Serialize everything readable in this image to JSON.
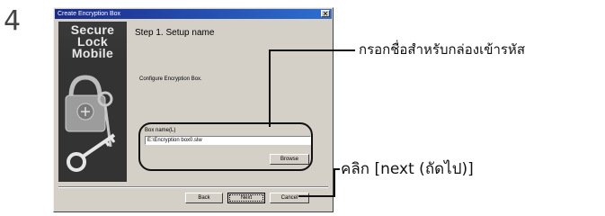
{
  "step_number": "4",
  "dialog": {
    "title": "Create Encryption Box",
    "close_glyph": "✕",
    "logo_lines": [
      "Secure",
      "Lock",
      "Mobile"
    ],
    "heading": "Step 1. Setup name",
    "description": "Configure Encryption Box.",
    "box_name_label": "Box name(L)",
    "box_name_value": "E:\\Encryption box0.slw",
    "browse_label": "Browse",
    "back_label": "Back",
    "next_label": "Next",
    "cancel_label": "Cancel"
  },
  "annotations": {
    "box_name_callout": "กรอกชื่อสำหรับกล่องเข้ารหัส",
    "next_callout": "คลิก [next (ถัดไป)]"
  },
  "colors": {
    "titlebar_start": "#1a2a8a",
    "titlebar_end": "#2d6ed0",
    "dialog_face": "#d4d0c8",
    "side_panel": "#2a2a2a"
  }
}
